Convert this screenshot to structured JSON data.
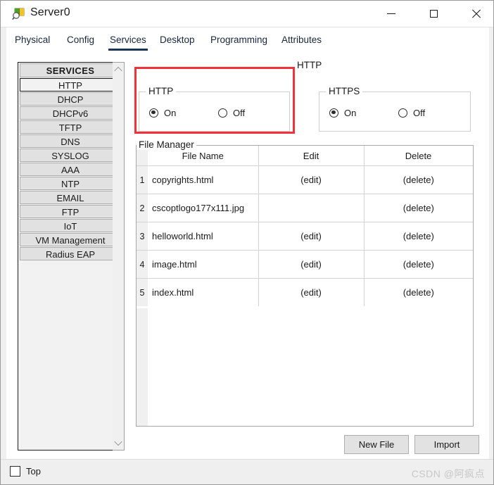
{
  "window": {
    "title": "Server0",
    "icon": "server-package-icon",
    "controls": {
      "minimize": "minimize-icon",
      "maximize": "maximize-icon",
      "close": "close-icon"
    }
  },
  "tabs": [
    {
      "label": "Physical",
      "active": false
    },
    {
      "label": "Config",
      "active": false
    },
    {
      "label": "Services",
      "active": true
    },
    {
      "label": "Desktop",
      "active": false
    },
    {
      "label": "Programming",
      "active": false
    },
    {
      "label": "Attributes",
      "active": false
    }
  ],
  "sidebar": {
    "header": "SERVICES",
    "items": [
      {
        "label": "HTTP",
        "selected": true
      },
      {
        "label": "DHCP",
        "selected": false
      },
      {
        "label": "DHCPv6",
        "selected": false
      },
      {
        "label": "TFTP",
        "selected": false
      },
      {
        "label": "DNS",
        "selected": false
      },
      {
        "label": "SYSLOG",
        "selected": false
      },
      {
        "label": "AAA",
        "selected": false
      },
      {
        "label": "NTP",
        "selected": false
      },
      {
        "label": "EMAIL",
        "selected": false
      },
      {
        "label": "FTP",
        "selected": false
      },
      {
        "label": "IoT",
        "selected": false
      },
      {
        "label": "VM Management",
        "selected": false
      },
      {
        "label": "Radius EAP",
        "selected": false
      }
    ],
    "scroll_up_icon": "chevron-up-icon",
    "scroll_down_icon": "chevron-down-icon"
  },
  "annotation": {
    "label": "HTTP",
    "color": "#f0333a"
  },
  "http_group": {
    "title": "HTTP",
    "on_label": "On",
    "off_label": "Off",
    "selected": "On"
  },
  "https_group": {
    "title": "HTTPS",
    "on_label": "On",
    "off_label": "Off",
    "selected": "On"
  },
  "file_manager": {
    "title": "File Manager",
    "columns": [
      "File Name",
      "Edit",
      "Delete"
    ],
    "rows": [
      {
        "index": "1",
        "name": "copyrights.html",
        "edit": "(edit)",
        "delete": "(delete)"
      },
      {
        "index": "2",
        "name": "cscoptlogo177x111.jpg",
        "edit": "",
        "delete": "(delete)"
      },
      {
        "index": "3",
        "name": "helloworld.html",
        "edit": "(edit)",
        "delete": "(delete)"
      },
      {
        "index": "4",
        "name": "image.html",
        "edit": "(edit)",
        "delete": "(delete)"
      },
      {
        "index": "5",
        "name": "index.html",
        "edit": "(edit)",
        "delete": "(delete)"
      }
    ],
    "buttons": {
      "new_file": "New File",
      "import": "Import"
    }
  },
  "statusbar": {
    "top_checkbox_label": "Top",
    "top_checked": false,
    "watermark": "CSDN @阿疯点"
  }
}
